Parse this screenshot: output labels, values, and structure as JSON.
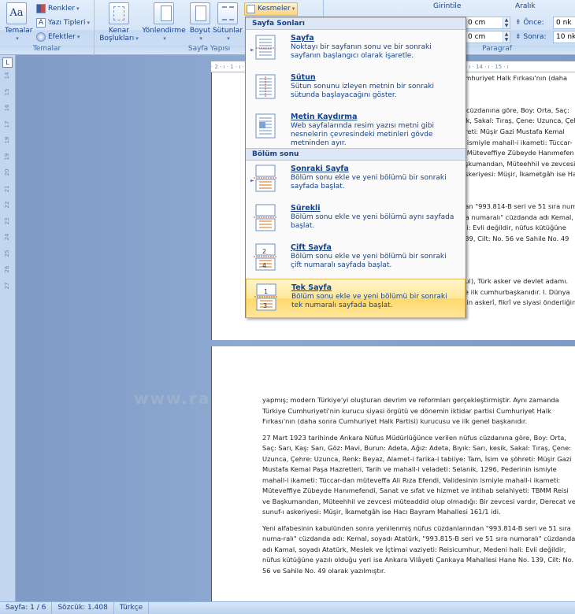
{
  "ribbon": {
    "temalar": {
      "themes": "Temalar",
      "colors": "Renkler",
      "fonts": "Yazı Tipleri",
      "effects": "Efektler",
      "group": "Temalar"
    },
    "page_setup": {
      "margins": "Kenar Boşlukları",
      "orientation": "Yönlendirme",
      "size": "Boyut",
      "columns": "Sütunlar",
      "breaks": "Kesmeler",
      "group": "Sayfa Yapısı"
    },
    "paragraph": {
      "indent_label": "Girintile",
      "indent_left": "0 cm",
      "indent_right": "0 cm",
      "spacing_label": "Aralık",
      "before_label": "Önce:",
      "before_value": "0 nk",
      "after_label": "Sonra:",
      "after_value": "10 nk",
      "group": "Paragraf"
    }
  },
  "hruler_text": "· 2 · ı · 1 · ı ·  ·  · ı · 1 · ı · 2 · ı · 3 · ı · 4 · ı · 5 · ı · 6 · ı · 7 · ı · 8 · ı · 9 · ı · 10 · ı · 11 · ı · 12 · ı · 13 · ı · 14 · ı · 15 · ı",
  "vruler_ticks": [
    "14",
    "15",
    "16",
    "17",
    "18",
    "19",
    "20",
    "21",
    "22",
    "23",
    "24",
    "25",
    "26",
    "27"
  ],
  "menu": {
    "section1": "Sayfa Sonları",
    "section2": "Bölüm sonu",
    "items": [
      {
        "title": "Sayfa",
        "desc": "Noktayı bir sayfanın sonu ve bir sonraki sayfanın başlangıcı olarak işaretle."
      },
      {
        "title": "Sütun",
        "desc": "Sütun sonunu izleyen metnin bir sonraki sütunda başlayacağını göster."
      },
      {
        "title": "Metin Kaydırma",
        "desc": "Web sayfalarında resim yazısı metni gibi nesnelerin çevresindeki metinleri gövde metninden ayır."
      },
      {
        "title": "Sonraki Sayfa",
        "desc": "Bölüm sonu ekle ve yeni bölümü bir sonraki sayfada başlat."
      },
      {
        "title": "Sürekli",
        "desc": "Bölüm sonu ekle ve yeni bölümü aynı sayfada başlat."
      },
      {
        "title": "Çift Sayfa",
        "desc": "Bölüm sonu ekle ve yeni bölümü bir sonraki çift numaralı sayfada başlat."
      },
      {
        "title": "Tek Sayfa",
        "desc": "Bölüm sonu ekle ve yeni bölümü bir sonraki tek numaralı sayfada başlat."
      }
    ]
  },
  "page1_lines": [
    "umhuriyet Halk Fırkası'nın (daha",
    "",
    "",
    "s cüzdanına göre, Boy: Orta, Saç:",
    "sik, Sakal: Tıraş, Çene: Uzunca, Çeh",
    "hreti: Müşir Gazi Mustafa Kemal",
    "n ismiyle mahall-i ikameti: Tüccar-",
    "i: Müteveffiye Zübeyde Hanımefen",
    "aşkumandan, Müteehhil ve zevcesi",
    "askeriyesi: Müşir, İkametgâh ise Hacı",
    "",
    "",
    "dan \"993.814-B seri ve 51 sıra numa-",
    "ıra numaralı\" cüzdanda adı Kemal,",
    "ali: Evli değildir, nüfus kütüğüne",
    "139, Cilt: No. 56 ve Sahile No. 49",
    "",
    "",
    "",
    "bul), Türk asker ve devlet adamı.",
    "ve ilk cumhurbaşkanıdır. I. Dünya",
    "'nin askerî, fikrî ve siyasi önderliğin"
  ],
  "page2_paragraphs": [
    "yapmış; modern Türkiye'yi oluşturan devrim ve reformları gerçekleştirmiştir. Aynı zamanda Türkiye Cumhuriyeti'nin kurucu siyasi örgütü ve dönemin iktidar partisi Cumhuriyet Halk Fırkası'nın (daha sonra Cumhuriyet Halk Partisi) kurucusu ve ilk genel başkanıdır.",
    "27 Mart 1923 tarihinde Ankara Nüfus Müdürlüğünce verilen nüfus cüzdanına göre, Boy: Orta, Saç: Sarı, Kaş: Sarı, Göz: Mavi, Burun: Adeta, Ağız: Adeta, Bıyık: Sarı, kesik, Sakal: Tıraş, Çene: Uzunca, Çehre: Uzunca, Renk: Beyaz, Alamet-i farika-i tabiiye: Tam, İsim ve şöhreti: Müşir Gazi Mustafa Kemal Paşa Hazretleri, Tarih ve mahall-i veladeti: Selanik, 1296, Pederinin ismiyle mahall-i ikameti: Tüccar-dan müteveffa Ali Rıza Efendi, Validesinin ismiyle mahall-i ikameti: Müteveffiye Zübeyde Hanımefendi, Sanat ve sıfat ve hizmet ve intihab selahiyeti: TBMM Reisi ve Başkumandan, Müteehhil ve zevcesi müteaddid olup olmadığı: Bir zevcesi vardır, Derecat ve sunuf-ı askeriyesi: Müşir, İkametgâh ise Hacı Bayram Mahallesi 161/1 idi.",
    "Yeni alfabesinin kabulünden sonra yenilenmiş nüfus cüzdanlarından \"993.814-B seri ve 51 sıra numa-ralı\" cüzdanda adı: Kemal, soyadı  Atatürk, \"993.815-B seri ve 51 sıra numaralı\" cüzdanda adı Kamal, soyadı Atatürk, Meslek ve İçtimai vaziyeti: Reisicumhur, Medeni hali: Evli değildir, nüfus kütüğüne yazılı olduğu yeri ise Ankara Vilâyeti Çankaya Mahallesi Hane No. 139, Cilt: No. 56 ve Sahile No. 49 olarak yazılmıştır."
  ],
  "watermark": "www.ra",
  "status": {
    "page": "Sayfa: 1 / 6",
    "words": "Sözcük: 1.408",
    "lang": "Türkçe"
  }
}
